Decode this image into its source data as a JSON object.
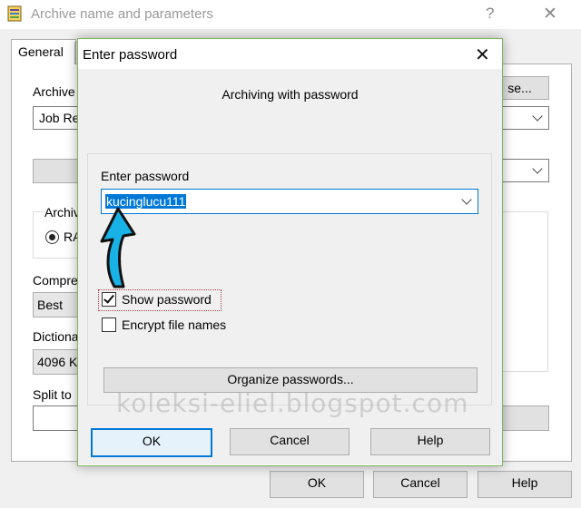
{
  "background_window": {
    "title": "Archive name and parameters",
    "help_glyph": "?",
    "close_glyph": "✕",
    "tab_general": "General",
    "archive_name_label": "Archive",
    "archive_name_value": "Job Re",
    "browse_label": "se...",
    "archive_format_label": "Archiv",
    "rar_label": "RA",
    "compression_label": "Compre",
    "compression_value": "Best",
    "dictionary_label": "Dictiona",
    "dictionary_value": "4096 K",
    "split_label": "Split to",
    "ok": "OK",
    "cancel": "Cancel",
    "help": "Help"
  },
  "dialog": {
    "title": "Enter password",
    "close_glyph": "✕",
    "heading": "Archiving with password",
    "password_label": "Enter password",
    "password_value": "kucinglucu111",
    "show_password_label": "Show password",
    "show_password_checked": true,
    "encrypt_names_label": "Encrypt file names",
    "encrypt_names_checked": false,
    "organize_label": "Organize passwords...",
    "ok": "OK",
    "cancel": "Cancel",
    "help": "Help"
  },
  "overlay": {
    "watermark": "koleksi-eliel.blogspot.com",
    "arrow_color": "#19b2e6",
    "arrow_icon": "curved-arrow-icon"
  }
}
